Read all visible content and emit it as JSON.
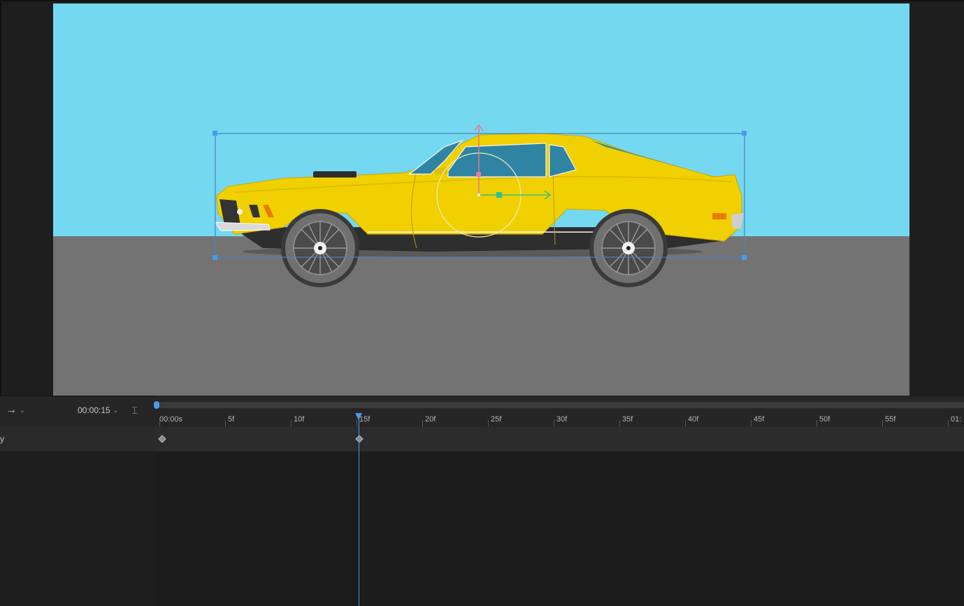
{
  "toolbar": {
    "direction_icon_glyph": "→",
    "direction_caret": "⌄",
    "timecode": "00:00:15",
    "timecode_caret": "⌄",
    "curve_icon_glyph": "⌶"
  },
  "ruler": {
    "labels": [
      "00:00s",
      "5f",
      "10f",
      "15f",
      "20f",
      "25f",
      "30f",
      "35f",
      "40f",
      "45f",
      "50f",
      "55f",
      "01:"
    ]
  },
  "track": {
    "label": "y",
    "keyframes": [
      "00:00s",
      "15f"
    ]
  },
  "playhead": {
    "frame": "15f"
  },
  "colors": {
    "sky": "#74d8f1",
    "ground": "#737373",
    "car_body": "#f0d000",
    "selection": "#4a9be8",
    "playhead": "#4a9be8"
  },
  "icons": [
    "arrow-right-icon",
    "chevron-down-icon",
    "curve-icon",
    "keyframe-icon",
    "playhead-icon",
    "anchor-point-icon",
    "x-axis-arrow-icon",
    "y-axis-arrow-icon"
  ]
}
